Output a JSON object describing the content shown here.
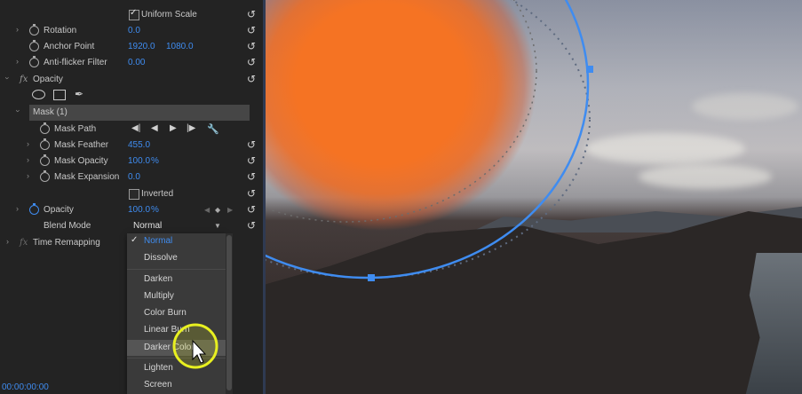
{
  "effect_controls": {
    "uniform_scale": {
      "label": "Uniform Scale",
      "checked": true
    },
    "rotation": {
      "label": "Rotation",
      "value": "0.0"
    },
    "anchor_point": {
      "label": "Anchor Point",
      "x": "1920.0",
      "y": "1080.0"
    },
    "anti_flicker": {
      "label": "Anti-flicker Filter",
      "value": "0.00"
    },
    "opacity_group": {
      "label": "Opacity",
      "fx": "fx"
    },
    "mask": {
      "label": "Mask (1)"
    },
    "mask_path": {
      "label": "Mask Path"
    },
    "mask_feather": {
      "label": "Mask Feather",
      "value": "455.0"
    },
    "mask_opacity": {
      "label": "Mask Opacity",
      "value": "100.0",
      "unit": "%"
    },
    "mask_expansion": {
      "label": "Mask Expansion",
      "value": "0.0"
    },
    "inverted": {
      "label": "Inverted",
      "checked": false
    },
    "opacity": {
      "label": "Opacity",
      "value": "100.0",
      "unit": "%"
    },
    "blend_mode": {
      "label": "Blend Mode",
      "value": "Normal"
    },
    "time_remapping": {
      "label": "Time Remapping",
      "fx": "fx"
    },
    "timecode": "00:00:00:00"
  },
  "blend_mode_options": [
    {
      "label": "Normal",
      "selected": true
    },
    {
      "label": "Dissolve"
    },
    {
      "label": "Darken"
    },
    {
      "label": "Multiply"
    },
    {
      "label": "Color Burn"
    },
    {
      "label": "Linear Burn"
    },
    {
      "label": "Darker Color",
      "hovered": true
    },
    {
      "label": "Lighten"
    },
    {
      "label": "Screen"
    }
  ],
  "colors": {
    "accent_blue": "#3f8cf0",
    "mask_color": "#f57323",
    "cursor_highlight": "#e8f020"
  }
}
